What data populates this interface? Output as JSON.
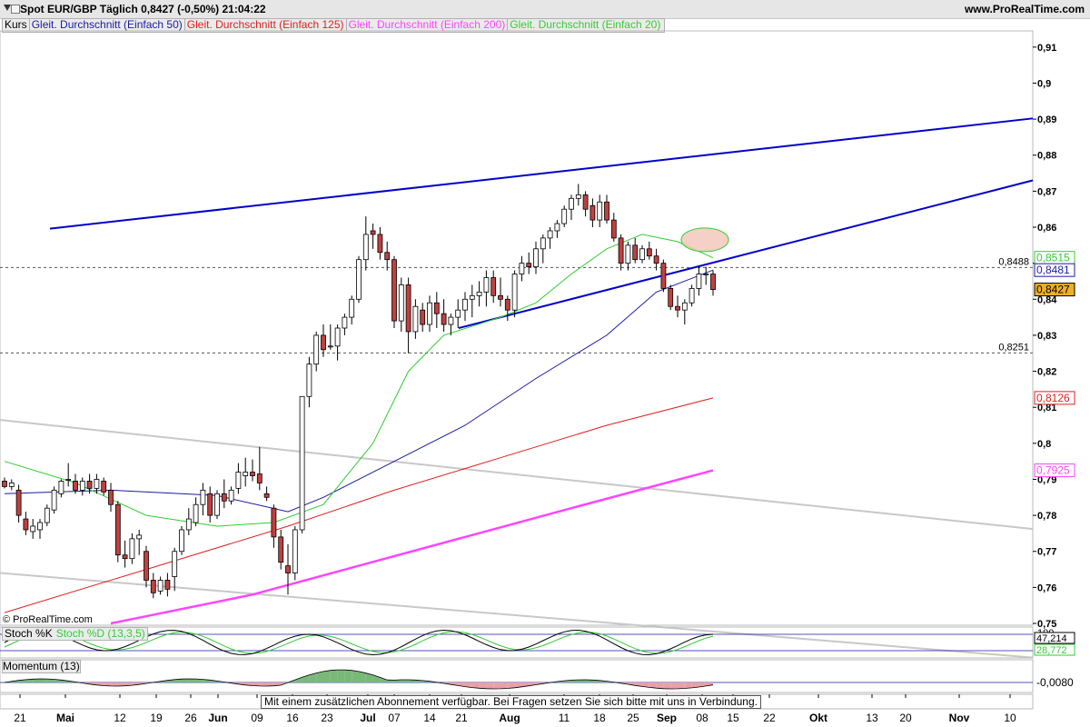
{
  "header": {
    "title": "Spot EUR/GBP   Täglich   0,8427 (-0,50%)   21:04:22",
    "brand": "www.ProRealTime.com"
  },
  "legend": {
    "items": [
      {
        "label": "Kurs",
        "color": "#000000"
      },
      {
        "label": "Gleit. Durchschnitt (Einfach 50)",
        "color": "#1a1aa6"
      },
      {
        "label": "Gleit. Durchschnitt (Einfach 125)",
        "color": "#e02020"
      },
      {
        "label": "Gleit. Durchschnitt (Einfach 200)",
        "color": "#ff44ff"
      },
      {
        "label": "Gleit. Durchschnitt (Einfach 20)",
        "color": "#33cc33"
      }
    ]
  },
  "copyright": "© ProRealTime.com",
  "banner": "Mit einem zusätzlichen Abonnement verfügbar. Bei Fragen setzen Sie sich bitte mit uns in Verbindung.",
  "stoch": {
    "label_k": "Stoch %K",
    "label_d": "Stoch %D (13,3,5)",
    "value_k": "47,214",
    "value_d": "28,772",
    "top_tick": "100"
  },
  "momentum": {
    "label": "Momentum (13)",
    "value": "-0,0080"
  },
  "chart_data": {
    "type": "candlestick",
    "title": "Spot EUR/GBP",
    "y_ticks": [
      "0,91",
      "0,9",
      "0,89",
      "0,88",
      "0,87",
      "0,86",
      "0,85",
      "0,84",
      "0,83",
      "0,82",
      "0,81",
      "0,8",
      "0,79",
      "0,78",
      "0,77",
      "0,76",
      "0,75"
    ],
    "ylim": [
      0.7495,
      0.9145
    ],
    "x_ticks": [
      "21",
      "Mai",
      "12",
      "19",
      "26",
      "Jun",
      "09",
      "16",
      "23",
      "Jul",
      "07",
      "14",
      "21",
      "Aug",
      "11",
      "18",
      "25",
      "Sep",
      "08",
      "15",
      "22",
      "Okt",
      "13",
      "20",
      "Nov",
      "10"
    ],
    "last_price": "0,8427",
    "levels": [
      {
        "label": "0,8488",
        "value": 0.8488
      },
      {
        "label": "0,8251",
        "value": 0.8251
      }
    ],
    "badges": [
      {
        "label": "0,8515",
        "value": 0.8515,
        "color": "#33cc33",
        "series": "Gleit. Durchschnitt (Einfach 20)"
      },
      {
        "label": "0,8481",
        "value": 0.8481,
        "color": "#1a1aa6",
        "series": "Gleit. Durchschnitt (Einfach 50)"
      },
      {
        "label": "0,8427",
        "value": 0.8427,
        "color": "#000000",
        "series": "Kurs"
      },
      {
        "label": "0,8126",
        "value": 0.8126,
        "color": "#e02020",
        "series": "Gleit. Durchschnitt (Einfach 125)"
      },
      {
        "label": "0,7925",
        "value": 0.7925,
        "color": "#ff44ff",
        "series": "Gleit. Durchschnitt (Einfach 200)"
      }
    ],
    "candles": [
      [
        0.7895,
        0.7905,
        0.7875,
        0.788
      ],
      [
        0.788,
        0.79,
        0.787,
        0.789
      ],
      [
        0.787,
        0.7885,
        0.778,
        0.78
      ],
      [
        0.779,
        0.781,
        0.7745,
        0.776
      ],
      [
        0.7755,
        0.779,
        0.7735,
        0.777
      ],
      [
        0.776,
        0.779,
        0.7735,
        0.778
      ],
      [
        0.778,
        0.783,
        0.777,
        0.782
      ],
      [
        0.7815,
        0.788,
        0.7805,
        0.787
      ],
      [
        0.786,
        0.79,
        0.785,
        0.7895
      ],
      [
        0.79,
        0.7945,
        0.788,
        0.79
      ],
      [
        0.7895,
        0.7915,
        0.786,
        0.787
      ],
      [
        0.787,
        0.7905,
        0.7855,
        0.7895
      ],
      [
        0.7895,
        0.7915,
        0.786,
        0.7875
      ],
      [
        0.7875,
        0.7915,
        0.786,
        0.79
      ],
      [
        0.7895,
        0.7905,
        0.7855,
        0.7865
      ],
      [
        0.787,
        0.789,
        0.781,
        0.783
      ],
      [
        0.783,
        0.784,
        0.767,
        0.769
      ],
      [
        0.769,
        0.773,
        0.7655,
        0.768
      ],
      [
        0.768,
        0.775,
        0.7665,
        0.7735
      ],
      [
        0.7735,
        0.776,
        0.769,
        0.7745
      ],
      [
        0.77,
        0.7715,
        0.76,
        0.762
      ],
      [
        0.762,
        0.764,
        0.757,
        0.7585
      ],
      [
        0.759,
        0.763,
        0.758,
        0.762
      ],
      [
        0.762,
        0.764,
        0.7575,
        0.7595
      ],
      [
        0.763,
        0.771,
        0.759,
        0.77
      ],
      [
        0.77,
        0.777,
        0.769,
        0.776
      ],
      [
        0.776,
        0.782,
        0.7745,
        0.779
      ],
      [
        0.778,
        0.785,
        0.777,
        0.783
      ],
      [
        0.783,
        0.789,
        0.78,
        0.787
      ],
      [
        0.786,
        0.788,
        0.778,
        0.78
      ],
      [
        0.78,
        0.787,
        0.779,
        0.786
      ],
      [
        0.786,
        0.79,
        0.782,
        0.784
      ],
      [
        0.784,
        0.788,
        0.783,
        0.787
      ],
      [
        0.7875,
        0.7945,
        0.786,
        0.792
      ],
      [
        0.791,
        0.796,
        0.788,
        0.792
      ],
      [
        0.792,
        0.7955,
        0.7895,
        0.791
      ],
      [
        0.7915,
        0.799,
        0.787,
        0.789
      ],
      [
        0.786,
        0.788,
        0.784,
        0.785
      ],
      [
        0.782,
        0.783,
        0.771,
        0.774
      ],
      [
        0.774,
        0.776,
        0.765,
        0.767
      ],
      [
        0.766,
        0.772,
        0.758,
        0.764
      ],
      [
        0.764,
        0.777,
        0.762,
        0.776
      ],
      [
        0.776,
        0.812,
        0.775,
        0.813
      ],
      [
        0.813,
        0.824,
        0.81,
        0.822
      ],
      [
        0.822,
        0.831,
        0.82,
        0.83
      ],
      [
        0.83,
        0.833,
        0.824,
        0.826
      ],
      [
        0.827,
        0.833,
        0.826,
        0.827
      ],
      [
        0.827,
        0.833,
        0.823,
        0.832
      ],
      [
        0.832,
        0.836,
        0.83,
        0.835
      ],
      [
        0.835,
        0.841,
        0.833,
        0.84
      ],
      [
        0.84,
        0.852,
        0.839,
        0.851
      ],
      [
        0.851,
        0.863,
        0.848,
        0.858
      ],
      [
        0.859,
        0.861,
        0.854,
        0.858
      ],
      [
        0.858,
        0.86,
        0.851,
        0.853
      ],
      [
        0.853,
        0.856,
        0.848,
        0.851
      ],
      [
        0.851,
        0.852,
        0.832,
        0.834
      ],
      [
        0.834,
        0.846,
        0.831,
        0.844
      ],
      [
        0.844,
        0.846,
        0.825,
        0.831
      ],
      [
        0.831,
        0.84,
        0.829,
        0.838
      ],
      [
        0.837,
        0.839,
        0.831,
        0.833
      ],
      [
        0.833,
        0.841,
        0.831,
        0.839
      ],
      [
        0.839,
        0.842,
        0.832,
        0.836
      ],
      [
        0.836,
        0.84,
        0.831,
        0.833
      ],
      [
        0.833,
        0.836,
        0.83,
        0.835
      ],
      [
        0.835,
        0.84,
        0.832,
        0.837
      ],
      [
        0.837,
        0.842,
        0.834,
        0.84
      ],
      [
        0.84,
        0.844,
        0.835,
        0.841
      ],
      [
        0.841,
        0.845,
        0.838,
        0.842
      ],
      [
        0.842,
        0.848,
        0.838,
        0.846
      ],
      [
        0.846,
        0.848,
        0.839,
        0.841
      ],
      [
        0.841,
        0.846,
        0.838,
        0.84
      ],
      [
        0.84,
        0.841,
        0.834,
        0.837
      ],
      [
        0.837,
        0.848,
        0.835,
        0.847
      ],
      [
        0.847,
        0.852,
        0.845,
        0.85
      ],
      [
        0.85,
        0.853,
        0.847,
        0.849
      ],
      [
        0.849,
        0.856,
        0.847,
        0.854
      ],
      [
        0.854,
        0.858,
        0.85,
        0.857
      ],
      [
        0.857,
        0.86,
        0.854,
        0.859
      ],
      [
        0.859,
        0.862,
        0.857,
        0.861
      ],
      [
        0.861,
        0.866,
        0.86,
        0.865
      ],
      [
        0.865,
        0.869,
        0.862,
        0.868
      ],
      [
        0.868,
        0.872,
        0.866,
        0.869
      ],
      [
        0.869,
        0.87,
        0.863,
        0.865
      ],
      [
        0.866,
        0.868,
        0.86,
        0.862
      ],
      [
        0.862,
        0.869,
        0.86,
        0.867
      ],
      [
        0.867,
        0.869,
        0.861,
        0.862
      ],
      [
        0.862,
        0.864,
        0.856,
        0.857
      ],
      [
        0.857,
        0.858,
        0.848,
        0.85
      ],
      [
        0.85,
        0.856,
        0.848,
        0.855
      ],
      [
        0.855,
        0.857,
        0.85,
        0.851
      ],
      [
        0.851,
        0.855,
        0.85,
        0.854
      ],
      [
        0.854,
        0.856,
        0.851,
        0.852
      ],
      [
        0.852,
        0.854,
        0.848,
        0.85
      ],
      [
        0.85,
        0.851,
        0.842,
        0.843
      ],
      [
        0.843,
        0.844,
        0.837,
        0.838
      ],
      [
        0.838,
        0.841,
        0.835,
        0.837
      ],
      [
        0.837,
        0.84,
        0.833,
        0.839
      ],
      [
        0.839,
        0.844,
        0.838,
        0.843
      ],
      [
        0.843,
        0.849,
        0.841,
        0.847
      ],
      [
        0.847,
        0.849,
        0.844,
        0.847
      ],
      [
        0.847,
        0.848,
        0.841,
        0.8427
      ]
    ],
    "series": [
      {
        "name": "Gleit. Durchschnitt (Einfach 50)",
        "color": "#1a1aa6",
        "values": [
          [
            0,
            0.786
          ],
          [
            15,
            0.787
          ],
          [
            30,
            0.7855
          ],
          [
            40,
            0.781
          ],
          [
            45,
            0.785
          ],
          [
            55,
            0.795
          ],
          [
            65,
            0.805
          ],
          [
            75,
            0.818
          ],
          [
            85,
            0.83
          ],
          [
            92,
            0.842
          ],
          [
            100,
            0.8481
          ]
        ]
      },
      {
        "name": "Gleit. Durchschnitt (Einfach 125)",
        "color": "#e02020",
        "values": [
          [
            0,
            0.753
          ],
          [
            20,
            0.765
          ],
          [
            40,
            0.777
          ],
          [
            55,
            0.787
          ],
          [
            70,
            0.796
          ],
          [
            85,
            0.805
          ],
          [
            100,
            0.8126
          ]
        ]
      },
      {
        "name": "Gleit. Durchschnitt (Einfach 200)",
        "color": "#ff44ff",
        "values": [
          [
            15,
            0.75
          ],
          [
            35,
            0.758
          ],
          [
            50,
            0.766
          ],
          [
            65,
            0.774
          ],
          [
            80,
            0.782
          ],
          [
            100,
            0.7925
          ]
        ]
      },
      {
        "name": "Gleit. Durchschnitt (Einfach 20)",
        "color": "#33cc33",
        "values": [
          [
            0,
            0.795
          ],
          [
            10,
            0.789
          ],
          [
            20,
            0.78
          ],
          [
            30,
            0.777
          ],
          [
            38,
            0.778
          ],
          [
            45,
            0.783
          ],
          [
            52,
            0.8
          ],
          [
            57,
            0.82
          ],
          [
            62,
            0.83
          ],
          [
            70,
            0.835
          ],
          [
            75,
            0.839
          ],
          [
            80,
            0.847
          ],
          [
            85,
            0.854
          ],
          [
            90,
            0.858
          ],
          [
            95,
            0.856
          ],
          [
            100,
            0.8515
          ]
        ]
      }
    ],
    "trendlines": [
      {
        "color": "#0000cc",
        "from": [
          55,
          0.8596
        ],
        "to": [
          1137,
          0.8902
        ]
      },
      {
        "color": "#0000cc",
        "from": [
          505,
          0.832
        ],
        "to": [
          1137,
          0.873
        ]
      },
      {
        "color": "#c8c8c8",
        "from": [
          0,
          0.8065
        ],
        "to": [
          1137,
          0.7762
        ]
      },
      {
        "color": "#c8c8c8",
        "from": [
          0,
          0.764
        ],
        "to": [
          1137,
          0.7405
        ]
      }
    ]
  }
}
